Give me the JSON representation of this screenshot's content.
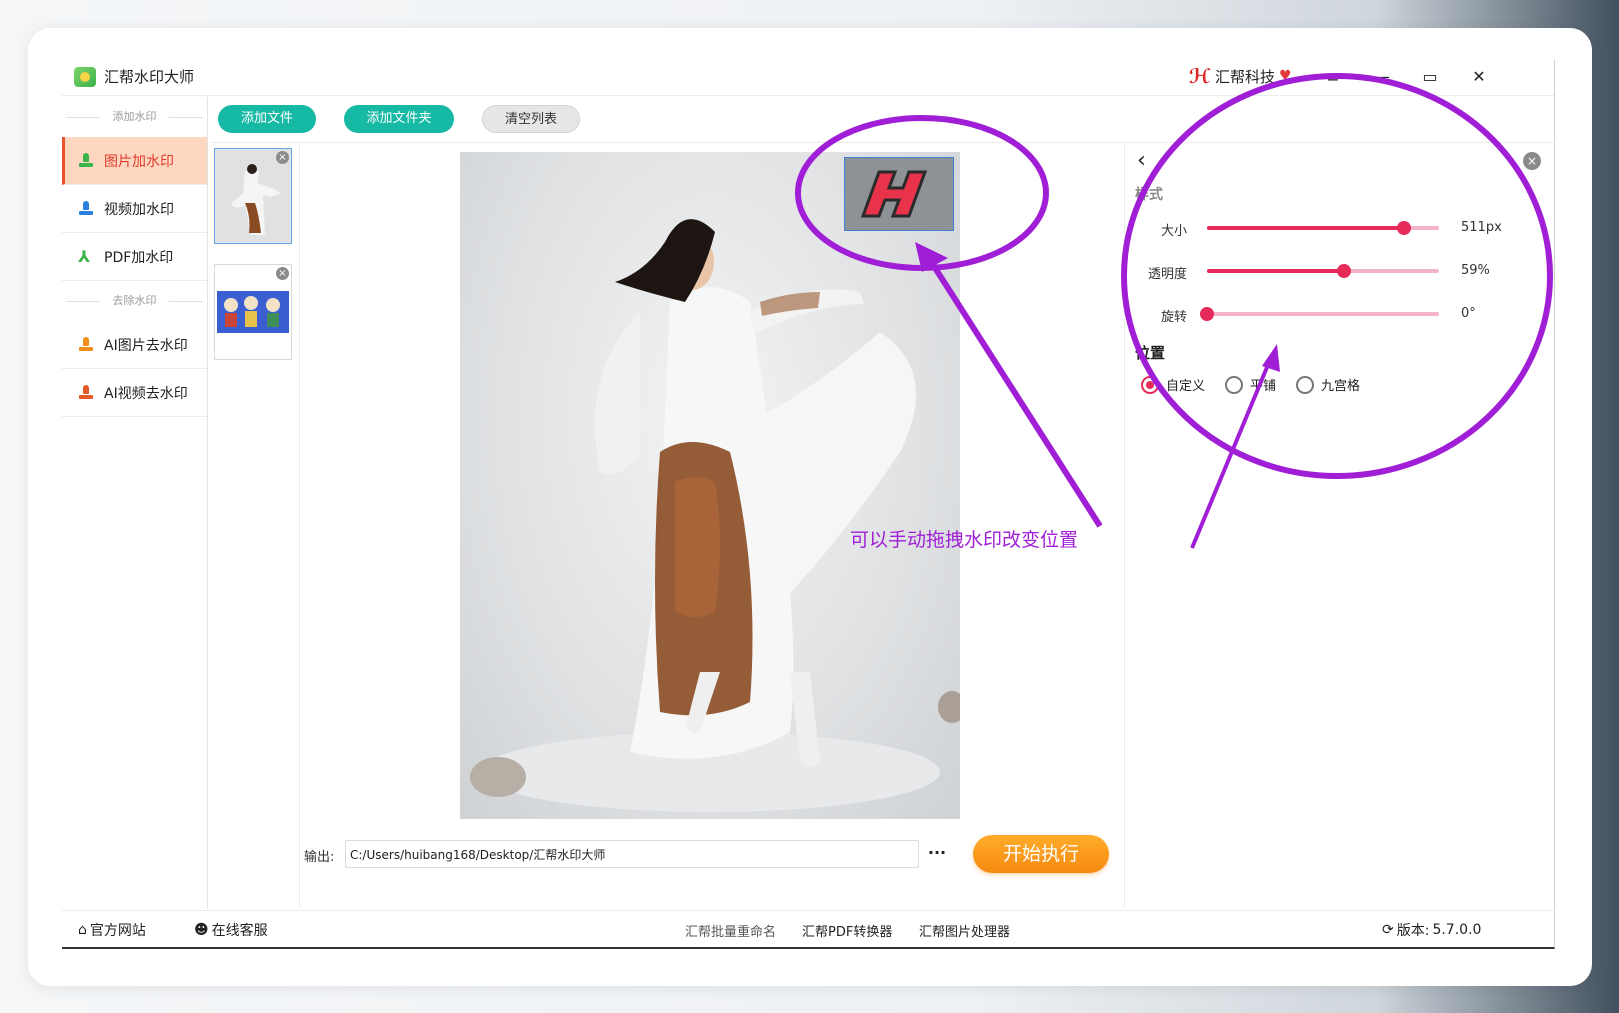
{
  "app": {
    "title": "汇帮水印大师",
    "brand": "汇帮科技"
  },
  "window_controls": {
    "menu": "≡",
    "minimize": "—",
    "maximize": "▭",
    "close": "✕"
  },
  "sidebar": {
    "section_add": "添加水印",
    "section_remove": "去除水印",
    "items": [
      {
        "label": "图片加水印",
        "icon": "stamp-icon",
        "color": "#3ab54a",
        "active": true
      },
      {
        "label": "视频加水印",
        "icon": "stamp-icon",
        "color": "#2a7fe0",
        "active": false
      },
      {
        "label": "PDF加水印",
        "icon": "pdf-icon",
        "color": "#3ab54a",
        "active": false
      },
      {
        "label": "AI图片去水印",
        "icon": "stamp-icon",
        "color": "#f0901a",
        "active": false
      },
      {
        "label": "AI视频去水印",
        "icon": "stamp-icon",
        "color": "#e55a2a",
        "active": false
      }
    ]
  },
  "toolbar": {
    "add_file": "添加文件",
    "add_folder": "添加文件夹",
    "clear_list": "清空列表"
  },
  "panel": {
    "style_title": "样式",
    "sliders": [
      {
        "label": "大小",
        "value": "511px",
        "fraction": 0.85
      },
      {
        "label": "透明度",
        "value": "59%",
        "fraction": 0.59
      },
      {
        "label": "旋转",
        "value": "0°",
        "fraction": 0.0
      }
    ],
    "position_title": "位置",
    "position_options": [
      {
        "label": "自定义",
        "checked": true
      },
      {
        "label": "平铺",
        "checked": false
      },
      {
        "label": "九宫格",
        "checked": false
      }
    ]
  },
  "output": {
    "label": "输出:",
    "path": "C:/Users/huibang168/Desktop/汇帮水印大师",
    "more": "···"
  },
  "start_button": "开始执行",
  "statusbar": {
    "official_site": "官方网站",
    "online_service": "在线客服",
    "links": [
      "汇帮批量重命名",
      "汇帮PDF转换器",
      "汇帮图片处理器"
    ],
    "version_label": "版本:",
    "version": "5.7.0.0"
  },
  "annotation": {
    "text": "可以手动拖拽水印改变位置",
    "color": "#a01fd6"
  },
  "colors": {
    "accent_teal": "#16b9a4",
    "slider_pink": "#e62a5a",
    "start_orange": "#f68a10",
    "active_nav_bg": "#fdd7c0"
  }
}
